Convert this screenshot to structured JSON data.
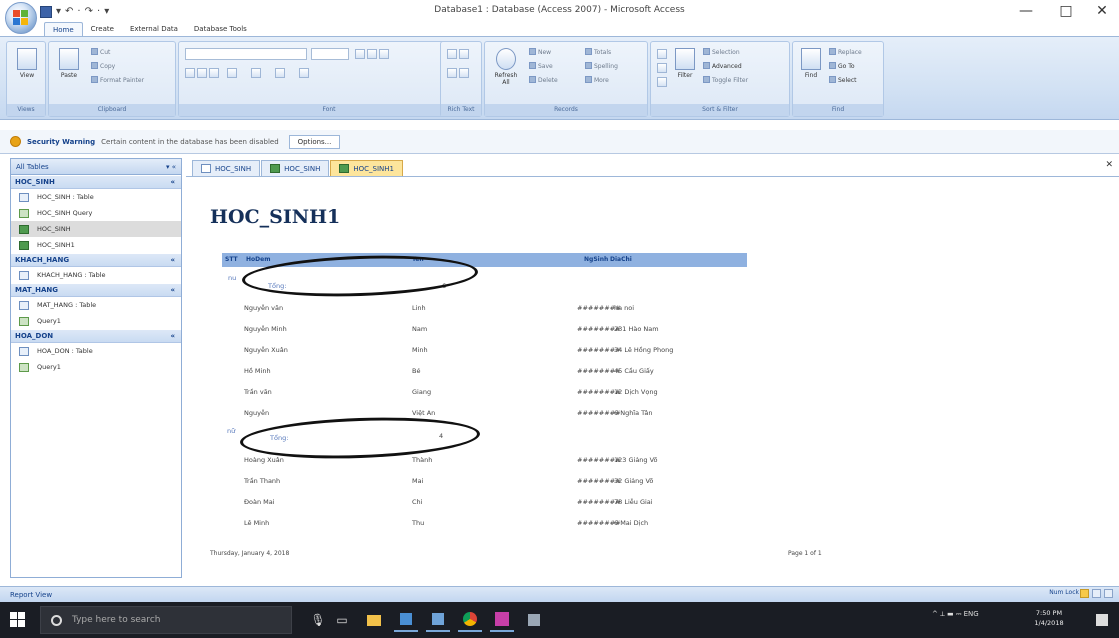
{
  "window": {
    "title": "Database1 : Database (Access 2007) - Microsoft Access",
    "qat_items": [
      "▾",
      "↶",
      "·",
      "↷",
      "·",
      "▾"
    ],
    "controls": {
      "minimize": "—",
      "maximize": "□",
      "close": "✕"
    }
  },
  "ribbon": {
    "tabs": [
      "Home",
      "Create",
      "External Data",
      "Database Tools"
    ],
    "groups": [
      "Views",
      "Clipboard",
      "Font",
      "Rich Text",
      "Records",
      "Sort & Filter",
      "Find"
    ],
    "buttons": {
      "view": "View",
      "paste": "Paste",
      "cut": "Cut",
      "copy": "Copy",
      "format_painter": "Format Painter",
      "refresh": "Refresh All",
      "new": "New",
      "save": "Save",
      "delete": "Delete",
      "totals": "Totals",
      "spelling": "Spelling",
      "more": "More",
      "filter": "Filter",
      "selection": "Selection",
      "advanced": "Advanced",
      "toggle_filter": "Toggle Filter",
      "find": "Find",
      "replace": "Replace",
      "goto": "Go To",
      "select": "Select"
    }
  },
  "security": {
    "title": "Security Warning",
    "message": "Certain content in the database has been disabled",
    "options": "Options..."
  },
  "nav": {
    "header": "All Tables",
    "header_ctl": "▾ «",
    "groups": [
      {
        "name": "HOC_SINH",
        "items": [
          "HOC_SINH : Table",
          "HOC_SINH Query",
          "HOC_SINH",
          "HOC_SINH1"
        ]
      },
      {
        "name": "KHACH_HANG",
        "items": [
          "KHACH_HANG : Table"
        ]
      },
      {
        "name": "MAT_HANG",
        "items": [
          "MAT_HANG : Table",
          "Query1"
        ]
      },
      {
        "name": "HOA_DON",
        "items": [
          "HOA_DON : Table",
          "Query1"
        ]
      }
    ],
    "collapse": "«"
  },
  "doc_tabs": [
    "HOC_SINH",
    "HOC_SINH",
    "HOC_SINH1"
  ],
  "doc_close": "✕",
  "report": {
    "title": "HOC_SINH1",
    "headers": [
      "STT",
      "HoDem",
      "Ten",
      "NgSinh",
      "DiaChi"
    ],
    "group1": {
      "key": "nu",
      "total_label": "Tổng:",
      "total_value": "6"
    },
    "rows1": [
      {
        "hodem": "Nguyễn văn",
        "ten": "Linh",
        "ngsinh": "########",
        "diachi": "ha noi"
      },
      {
        "hodem": "Nguyễn Minh",
        "ten": "Nam",
        "ngsinh": "########",
        "diachi": "231 Hào Nam"
      },
      {
        "hodem": "Nguyễn Xuân",
        "ten": "Minh",
        "ngsinh": "########",
        "diachi": "34 Lê Hồng Phong"
      },
      {
        "hodem": "Hồ Minh",
        "ten": "Bé",
        "ngsinh": "########",
        "diachi": "45 Cầu Giấy"
      },
      {
        "hodem": "Trần văn",
        "ten": "Giang",
        "ngsinh": "########",
        "diachi": "12 Dịch Vọng"
      },
      {
        "hodem": "Nguyễn",
        "ten": "Việt An",
        "ngsinh": "########",
        "diachi": "6 Nghĩa Tân"
      }
    ],
    "group2": {
      "key": "nữ",
      "total_label": "Tổng:",
      "total_value": "4"
    },
    "rows2": [
      {
        "hodem": "Hoàng Xuân",
        "ten": "Thành",
        "ngsinh": "########",
        "diachi": "123 Giảng Võ"
      },
      {
        "hodem": "Trần Thanh",
        "ten": "Mai",
        "ngsinh": "########",
        "diachi": "32 Giảng Võ"
      },
      {
        "hodem": "Đoàn Mai",
        "ten": "Chi",
        "ngsinh": "########",
        "diachi": "78 Liễu Giai"
      },
      {
        "hodem": "Lê Minh",
        "ten": "Thu",
        "ngsinh": "########",
        "diachi": "6 Mai Dịch"
      }
    ],
    "footer_date": "Thursday, January 4, 2018",
    "footer_page": "Page 1 of 1"
  },
  "status": {
    "left": "Report View",
    "right": "Num Lock"
  },
  "taskbar": {
    "search_placeholder": "Type here to search",
    "tray": "^ ⟂ ▬ ⎓ ENG",
    "time": "7:50 PM",
    "date": "1/4/2018"
  },
  "colors": {
    "ribbon": "#d3e2f4",
    "header_band": "#8fb1e0",
    "accent": "#15428b",
    "taskbar": "#1a1d24"
  }
}
